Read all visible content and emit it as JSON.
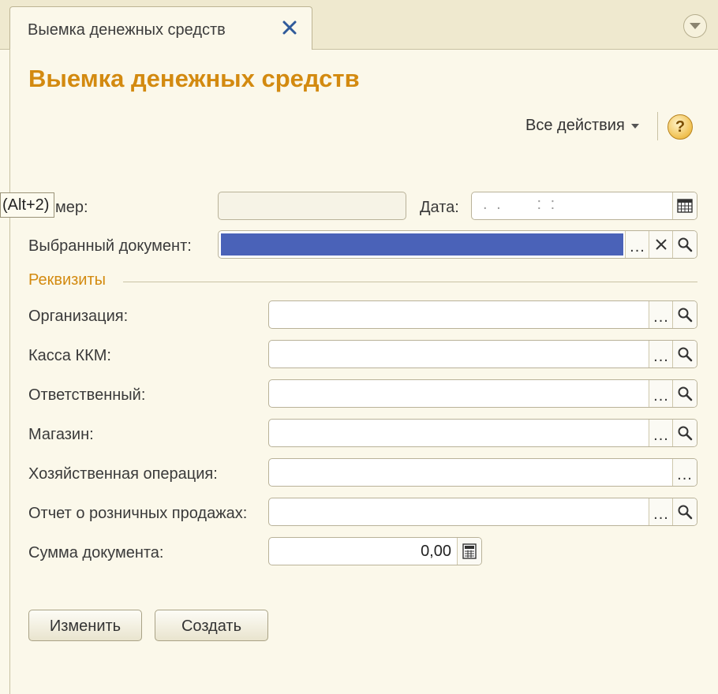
{
  "tab": {
    "title": "Выемка денежных средств"
  },
  "form": {
    "title": "Выемка денежных средств",
    "all_actions": "Все действия",
    "help": "?",
    "hotkey_hint": "(Alt+2)",
    "number_label": "мер:",
    "date_label": "Дата:",
    "date_mask": ". .     : :",
    "selected_doc_label": "Выбранный документ:",
    "section_title": "Реквизиты",
    "fields": [
      {
        "label": "Организация:"
      },
      {
        "label": "Касса ККМ:"
      },
      {
        "label": "Ответственный:"
      },
      {
        "label": "Магазин:"
      },
      {
        "label": "Хозяйственная операция:"
      },
      {
        "label": "Отчет о розничных продажах:"
      }
    ],
    "sum_label": "Сумма документа:",
    "sum_value": "0,00",
    "dots": "...",
    "edit_button": "Изменить",
    "create_button": "Создать"
  },
  "colors": {
    "accent_title": "#d38a10",
    "selection": "#4a62b8",
    "background": "#fbf8ea"
  }
}
